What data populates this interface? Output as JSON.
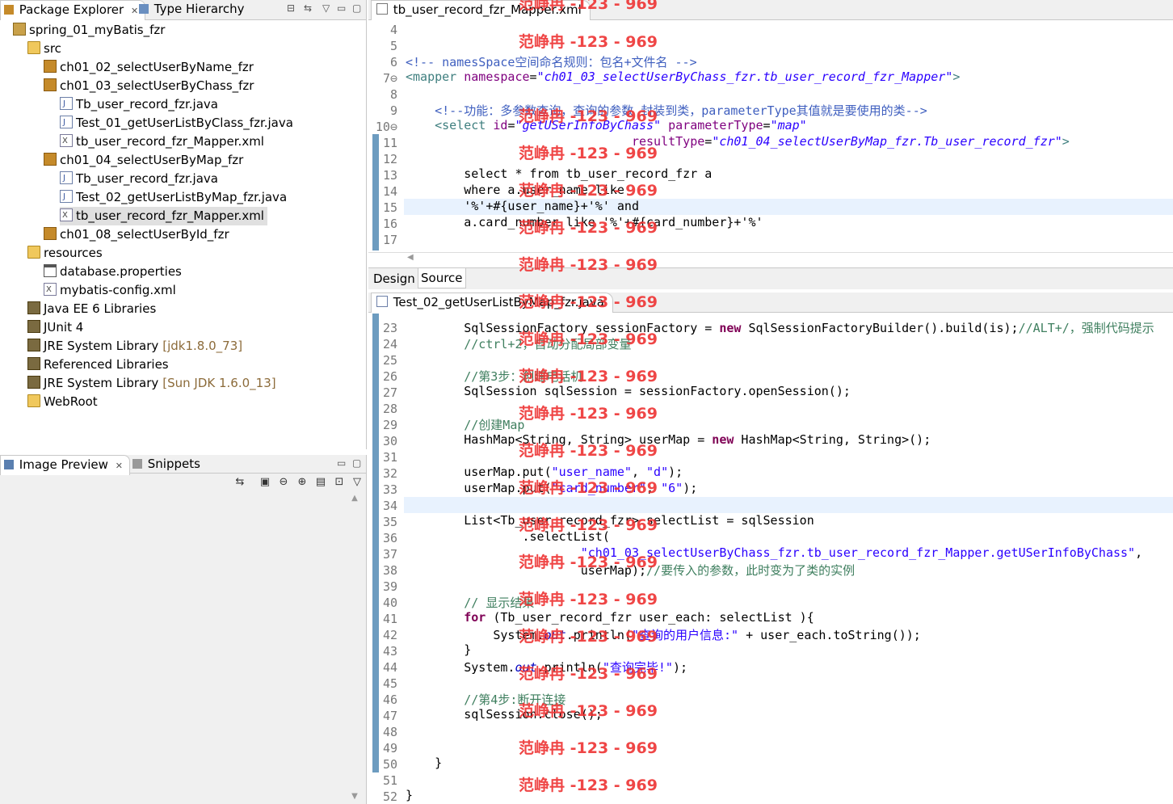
{
  "left_top_tabs": {
    "package_explorer": "Package Explorer",
    "type_hierarchy": "Type Hierarchy"
  },
  "tree": [
    {
      "label": "spring_01_myBatis_fzr",
      "icon": "project-icon",
      "depth": 0
    },
    {
      "label": "src",
      "icon": "source-folder-icon",
      "depth": 1
    },
    {
      "label": "ch01_02_selectUserByName_fzr",
      "icon": "package-icon",
      "depth": 2
    },
    {
      "label": "ch01_03_selectUserByChass_fzr",
      "icon": "package-icon",
      "depth": 2
    },
    {
      "label": "Tb_user_record_fzr.java",
      "icon": "java-file-icon",
      "depth": 3
    },
    {
      "label": "Test_01_getUserListByClass_fzr.java",
      "icon": "java-file-icon",
      "depth": 3
    },
    {
      "label": "tb_user_record_fzr_Mapper.xml",
      "icon": "xml-file-icon",
      "depth": 3
    },
    {
      "label": "ch01_04_selectUserByMap_fzr",
      "icon": "package-icon",
      "depth": 2
    },
    {
      "label": "Tb_user_record_fzr.java",
      "icon": "java-file-icon",
      "depth": 3
    },
    {
      "label": "Test_02_getUserListByMap_fzr.java",
      "icon": "java-file-icon",
      "depth": 3
    },
    {
      "label": "tb_user_record_fzr_Mapper.xml",
      "icon": "xml-file-icon",
      "depth": 3,
      "selected": true
    },
    {
      "label": "ch01_08_selectUserById_fzr",
      "icon": "package-icon",
      "depth": 2
    },
    {
      "label": "resources",
      "icon": "source-folder-icon",
      "depth": 1
    },
    {
      "label": "database.properties",
      "icon": "properties-file-icon",
      "depth": 2
    },
    {
      "label": "mybatis-config.xml",
      "icon": "xml-file-icon",
      "depth": 2
    },
    {
      "label": "Java EE 6 Libraries",
      "icon": "library-icon",
      "depth": 1
    },
    {
      "label": "JUnit 4",
      "icon": "library-icon",
      "depth": 1
    },
    {
      "label": "JRE System Library",
      "suffix": "[jdk1.8.0_73]",
      "icon": "library-icon",
      "depth": 1
    },
    {
      "label": "Referenced Libraries",
      "icon": "library-icon",
      "depth": 1
    },
    {
      "label": "JRE System Library",
      "suffix": "[Sun JDK 1.6.0_13]",
      "icon": "library-icon",
      "depth": 1
    },
    {
      "label": "WebRoot",
      "icon": "folder-icon",
      "depth": 1
    }
  ],
  "left_bottom_tabs": {
    "image_preview": "Image Preview",
    "snippets": "Snippets"
  },
  "xml_editor": {
    "tab_title": "tb_user_record_fzr_Mapper.xml",
    "bottom_tabs": {
      "design": "Design",
      "source": "Source"
    }
  },
  "java_editor": {
    "tab_title": "Test_02_getUserListByMap_fzr.java"
  },
  "watermark": "范峥冉 -123 - 969"
}
